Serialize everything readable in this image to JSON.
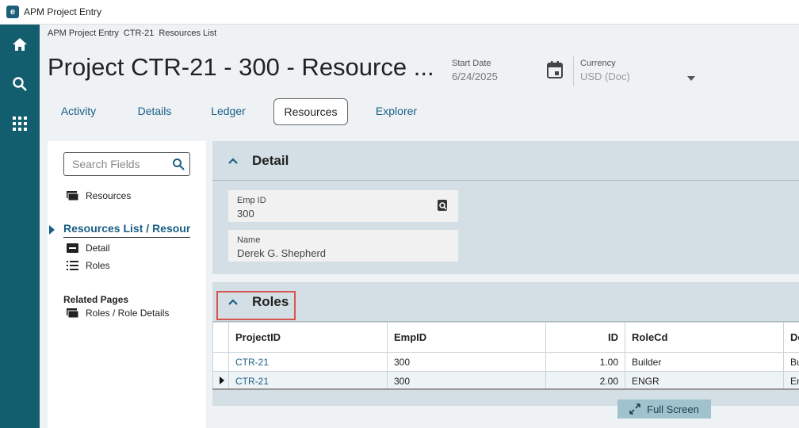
{
  "titlebar": {
    "logo": "e",
    "title": "APM Project Entry"
  },
  "rail": {
    "icons": [
      "home-icon",
      "search-icon",
      "apps-grid-icon"
    ]
  },
  "breadcrumb": [
    "APM Project Entry",
    "CTR-21",
    "Resources List"
  ],
  "page_title": "Project CTR-21 - 300 - Resource ...",
  "header": {
    "start_date_label": "Start Date",
    "start_date_value": "6/24/2025",
    "currency_label": "Currency",
    "currency_value": "USD (Doc)"
  },
  "tabs": [
    "Activity",
    "Details",
    "Ledger",
    "Resources",
    "Explorer"
  ],
  "active_tab": "Resources",
  "leftpanel": {
    "search_placeholder": "Search Fields",
    "resources_link": "Resources",
    "active_nav": "Resources List / Resourc...",
    "detail_link": "Detail",
    "roles_link": "Roles",
    "related_title": "Related Pages",
    "related_link": "Roles / Role Details"
  },
  "detail": {
    "title": "Detail",
    "emp_id_label": "Emp ID",
    "emp_id_value": "300",
    "name_label": "Name",
    "name_value": "Derek G. Shepherd"
  },
  "roles": {
    "title": "Roles",
    "columns": [
      "ProjectID",
      "EmpID",
      "ID",
      "RoleCd",
      "De"
    ],
    "rows": [
      [
        "CTR-21",
        "300",
        "1.00",
        "Builder",
        "Bu"
      ],
      [
        "CTR-21",
        "300",
        "2.00",
        "ENGR",
        "En"
      ]
    ],
    "fullscreen_label": "Full Screen"
  },
  "colors": {
    "rail": "#135e6e",
    "accent": "#1a5f86",
    "highlight": "#d9534f"
  }
}
